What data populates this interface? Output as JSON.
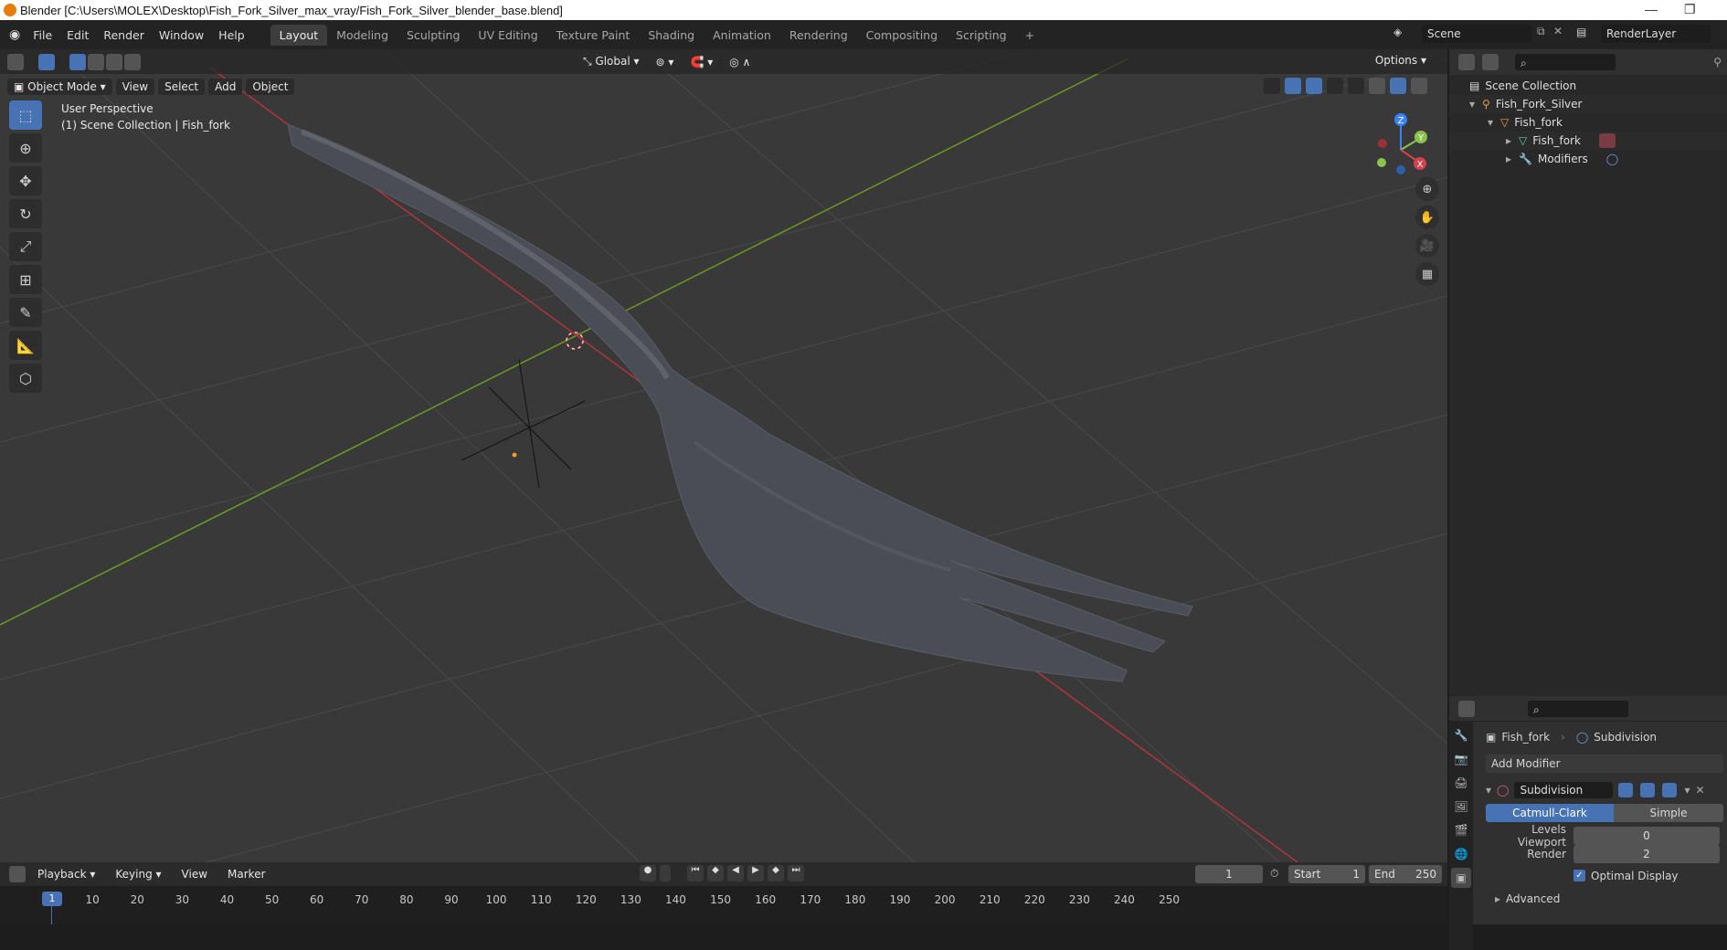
{
  "title": "Blender [C:\\Users\\MOLEX\\Desktop\\Fish_Fork_Silver_max_vray/Fish_Fork_Silver_blender_base.blend]",
  "menus": [
    "File",
    "Edit",
    "Render",
    "Window",
    "Help"
  ],
  "workspaces": [
    "Layout",
    "Modeling",
    "Sculpting",
    "UV Editing",
    "Texture Paint",
    "Shading",
    "Animation",
    "Rendering",
    "Compositing",
    "Scripting"
  ],
  "active_workspace": "Layout",
  "scene": "Scene",
  "render_layer": "RenderLayer",
  "header": {
    "transform_orientation": "Global",
    "options": "Options",
    "mode": "Object Mode",
    "view_menus": [
      "View",
      "Select",
      "Add",
      "Object"
    ]
  },
  "viewport": {
    "perspective": "User Perspective",
    "collection": "(1) Scene Collection | Fish_fork"
  },
  "gizmo": {
    "z": "Z",
    "y": "Y",
    "x": "X"
  },
  "outliner": {
    "items": [
      "Scene Collection",
      "Fish_Fork_Silver",
      "Fish_fork",
      "Fish_fork",
      "Modifiers"
    ]
  },
  "properties": {
    "object": "Fish_fork",
    "modifier_crumb": "Subdivision",
    "add_modifier": "Add Modifier",
    "modifier_name": "Subdivision",
    "types": [
      "Catmull-Clark",
      "Simple"
    ],
    "levels_viewport_label": "Levels Viewport",
    "levels_viewport": "0",
    "render_label": "Render",
    "render": "2",
    "optimal_display": "Optimal Display",
    "advanced": "Advanced"
  },
  "timeline": {
    "menus": [
      "Playback",
      "Keying",
      "View",
      "Marker"
    ],
    "current_frame": "1",
    "start_label": "Start",
    "start": "1",
    "end_label": "End",
    "end": "250",
    "ticks": [
      "10",
      "20",
      "30",
      "40",
      "50",
      "60",
      "70",
      "80",
      "90",
      "100",
      "110",
      "120",
      "130",
      "140",
      "150",
      "160",
      "170",
      "180",
      "190",
      "200",
      "210",
      "220",
      "230",
      "240",
      "250"
    ],
    "current_marker": "1"
  },
  "colors": {
    "accent": "#4772b3",
    "x_axis": "#d6404a",
    "y_axis": "#8bc34a",
    "z_axis": "#3b82f6"
  }
}
